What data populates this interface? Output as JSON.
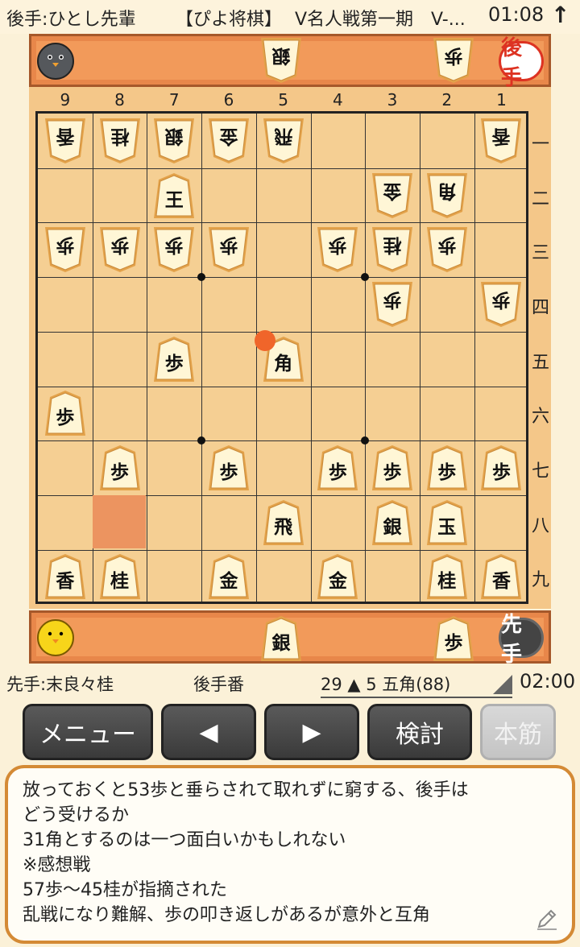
{
  "header": {
    "gote_player": "後手:ひとし先輩",
    "app_title": "【ぴよ将棋】",
    "event": "V名人戦第一期　V-...",
    "timer": "01:08",
    "top_icon": "up-arrow-icon"
  },
  "gote_hand": {
    "pieces": [
      "銀",
      "歩"
    ],
    "badge": "後手",
    "avatar": "gray-chick-icon"
  },
  "sente_hand": {
    "pieces": [
      "銀",
      "歩"
    ],
    "badge": "先手",
    "avatar": "yellow-chick-icon"
  },
  "board": {
    "files": [
      "9",
      "8",
      "7",
      "6",
      "5",
      "4",
      "3",
      "2",
      "1"
    ],
    "ranks": [
      "一",
      "二",
      "三",
      "四",
      "五",
      "六",
      "七",
      "八",
      "九"
    ],
    "pieces": [
      {
        "file": 9,
        "rank": 1,
        "char": "香",
        "side": "gote"
      },
      {
        "file": 8,
        "rank": 1,
        "char": "桂",
        "side": "gote"
      },
      {
        "file": 7,
        "rank": 1,
        "char": "銀",
        "side": "gote"
      },
      {
        "file": 6,
        "rank": 1,
        "char": "金",
        "side": "gote"
      },
      {
        "file": 5,
        "rank": 1,
        "char": "飛",
        "side": "gote"
      },
      {
        "file": 1,
        "rank": 1,
        "char": "香",
        "side": "gote"
      },
      {
        "file": 7,
        "rank": 2,
        "char": "王",
        "side": "sente"
      },
      {
        "file": 3,
        "rank": 2,
        "char": "金",
        "side": "gote"
      },
      {
        "file": 2,
        "rank": 2,
        "char": "角",
        "side": "gote"
      },
      {
        "file": 9,
        "rank": 3,
        "char": "歩",
        "side": "gote"
      },
      {
        "file": 8,
        "rank": 3,
        "char": "歩",
        "side": "gote"
      },
      {
        "file": 7,
        "rank": 3,
        "char": "歩",
        "side": "gote"
      },
      {
        "file": 6,
        "rank": 3,
        "char": "歩",
        "side": "gote"
      },
      {
        "file": 4,
        "rank": 3,
        "char": "歩",
        "side": "gote"
      },
      {
        "file": 3,
        "rank": 3,
        "char": "桂",
        "side": "gote"
      },
      {
        "file": 2,
        "rank": 3,
        "char": "歩",
        "side": "gote"
      },
      {
        "file": 3,
        "rank": 4,
        "char": "歩",
        "side": "gote"
      },
      {
        "file": 1,
        "rank": 4,
        "char": "歩",
        "side": "gote"
      },
      {
        "file": 7,
        "rank": 5,
        "char": "歩",
        "side": "sente"
      },
      {
        "file": 5,
        "rank": 5,
        "char": "角",
        "side": "sente"
      },
      {
        "file": 9,
        "rank": 6,
        "char": "歩",
        "side": "sente"
      },
      {
        "file": 8,
        "rank": 7,
        "char": "歩",
        "side": "sente"
      },
      {
        "file": 6,
        "rank": 7,
        "char": "歩",
        "side": "sente"
      },
      {
        "file": 4,
        "rank": 7,
        "char": "歩",
        "side": "sente"
      },
      {
        "file": 3,
        "rank": 7,
        "char": "歩",
        "side": "sente"
      },
      {
        "file": 2,
        "rank": 7,
        "char": "歩",
        "side": "sente"
      },
      {
        "file": 1,
        "rank": 7,
        "char": "歩",
        "side": "sente"
      },
      {
        "file": 5,
        "rank": 8,
        "char": "飛",
        "side": "sente"
      },
      {
        "file": 3,
        "rank": 8,
        "char": "銀",
        "side": "sente"
      },
      {
        "file": 2,
        "rank": 8,
        "char": "玉",
        "side": "sente"
      },
      {
        "file": 9,
        "rank": 9,
        "char": "香",
        "side": "sente"
      },
      {
        "file": 8,
        "rank": 9,
        "char": "桂",
        "side": "sente"
      },
      {
        "file": 6,
        "rank": 9,
        "char": "金",
        "side": "sente"
      },
      {
        "file": 4,
        "rank": 9,
        "char": "金",
        "side": "sente"
      },
      {
        "file": 2,
        "rank": 9,
        "char": "桂",
        "side": "sente"
      },
      {
        "file": 1,
        "rank": 9,
        "char": "香",
        "side": "sente"
      }
    ],
    "highlight_square": {
      "file": 8,
      "rank": 8
    },
    "last_move_marker": {
      "file": 5,
      "rank": 5
    }
  },
  "status": {
    "sente_player": "先手:末良々桂",
    "turn": "後手番",
    "move": "29 ▲ 5 五角(88)",
    "clock": "02:00"
  },
  "buttons": {
    "menu": "メニュー",
    "prev": "◀",
    "next": "▶",
    "analyze": "検討",
    "mainline": "本筋"
  },
  "comment": {
    "lines": [
      "放っておくと53歩と垂らされて取れずに窮する、後手は",
      "どう受けるか",
      "31角とするのは一つ面白いかもしれない",
      "※感想戦",
      "57歩〜45桂が指摘された",
      "乱戦になり難解、歩の叩き返しがあるが意外と互角"
    ],
    "edit_icon": "pencil-icon"
  },
  "colors": {
    "board": "#f5cf93",
    "hand_bar": "#f29a5a",
    "accent_orange": "#d48a35",
    "last_move": "#f0652a",
    "button": "#444444"
  }
}
